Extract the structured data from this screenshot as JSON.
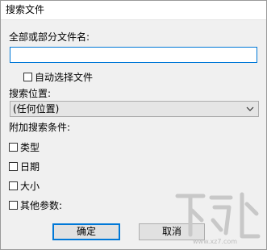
{
  "window": {
    "title": "搜索文件"
  },
  "form": {
    "name_label": "全部或部分文件名:",
    "name_value": "",
    "auto_select_label": "自动选择文件",
    "location_label": "搜索位置:",
    "location_value": "(任何位置)",
    "extra_label": "附加搜索条件:",
    "conditions": [
      "类型",
      "日期",
      "大小",
      "其他参数:"
    ]
  },
  "buttons": {
    "ok": "确定",
    "cancel": "取消"
  },
  "watermark": {
    "url": "www.xz7.com"
  },
  "colors": {
    "accent": "#0078d7",
    "dialog_bg": "#f0f0f0"
  },
  "icons": {
    "dropdown": "chevron-down-icon",
    "watermark": "site-logo"
  }
}
